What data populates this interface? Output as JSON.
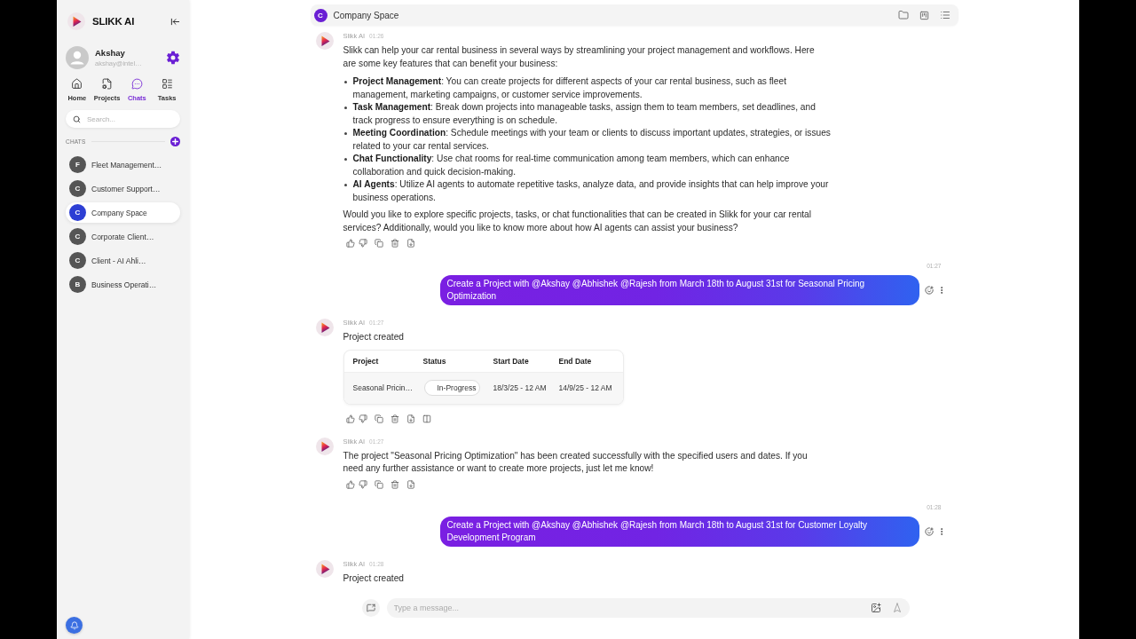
{
  "sidebar": {
    "brand": "SLIKK AI",
    "user": {
      "name": "Akshay",
      "email": "akshay@intel…"
    },
    "nav": [
      {
        "label": "Home",
        "selected": false
      },
      {
        "label": "Projects",
        "selected": false
      },
      {
        "label": "Chats",
        "selected": true
      },
      {
        "label": "Tasks",
        "selected": false
      }
    ],
    "search": {
      "placeholder": "Search..."
    },
    "chats_label": "CHATS",
    "chats": [
      {
        "initial": "F",
        "name": "Fleet Management…",
        "selected": false
      },
      {
        "initial": "C",
        "name": "Customer Support…",
        "selected": false
      },
      {
        "initial": "C",
        "name": "Company Space",
        "selected": true
      },
      {
        "initial": "C",
        "name": "Corporate Client…",
        "selected": false
      },
      {
        "initial": "C",
        "name": "Client - AI Ahli…",
        "selected": false
      },
      {
        "initial": "B",
        "name": "Business Operati…",
        "selected": false
      }
    ]
  },
  "header": {
    "initial": "C",
    "title": "Company Space"
  },
  "messages": [
    {
      "kind": "ai",
      "sender": "Slikk AI",
      "time": "01:26",
      "blocks": [
        {
          "kind": "paragraph",
          "text": "Slikk can help your car rental business in several ways by streamlining your project management and workflows. Here are some key features that can benefit your business:"
        },
        {
          "kind": "list",
          "items": [
            "**Project Management**: You can create projects for different aspects of your car rental business, such as fleet management, marketing campaigns, or customer service improvements.",
            "**Task Management**: Break down projects into manageable tasks, assign them to team members, set deadlines, and track progress to ensure everything is on schedule.",
            "**Meeting Coordination**: Schedule meetings with your team or clients to discuss important updates, strategies, or issues related to your car rental services.",
            "**Chat Functionality**: Use chat rooms for real-time communication among team members, which can enhance collaboration and quick decision-making.",
            "**AI Agents**: Utilize AI agents to automate repetitive tasks, analyze data, and provide insights that can help improve your business operations."
          ]
        },
        {
          "kind": "paragraph",
          "text": "Would you like to explore specific projects, tasks, or chat functionalities that can be created in Slikk for your car rental services? Additionally, would you like to know more about how AI agents can assist your business?"
        }
      ],
      "toolbar": true
    },
    {
      "kind": "user",
      "time": "01:27",
      "text": "Create a Project with @Akshay @Abhishek @Rajesh from March 18th to August 31st for Seasonal Pricing Optimization"
    },
    {
      "kind": "ai",
      "sender": "Slikk AI",
      "time": "01:27",
      "blocks": [
        {
          "kind": "paragraph",
          "text": "Project created"
        }
      ],
      "table": {
        "columns": [
          "Project",
          "Status",
          "Start Date",
          "End Date"
        ],
        "rows": [
          {
            "project": "Seasonal Pricin…",
            "status": "In-Progress",
            "start": "18/3/25 - 12 AM",
            "end": "14/9/25 - 12 AM"
          }
        ]
      },
      "toolbar": true
    },
    {
      "kind": "ai",
      "sender": "Slikk AI",
      "time": "01:27",
      "blocks": [
        {
          "kind": "paragraph",
          "text": "The project \"Seasonal Pricing Optimization\" has been created successfully with the specified users and dates. If you need any further assistance or want to create more projects, just let me know!"
        }
      ],
      "toolbar": true
    },
    {
      "kind": "user",
      "time": "01:28",
      "text": "Create a Project with @Akshay @Abhishek @Rajesh from March 18th to August 31st for Customer Loyalty Development Program"
    },
    {
      "kind": "ai",
      "sender": "Slikk AI",
      "time": "01:28",
      "blocks": [
        {
          "kind": "paragraph",
          "text": "Project created"
        }
      ],
      "toolbar": false
    }
  ],
  "composer": {
    "placeholder": "Type a message..."
  }
}
